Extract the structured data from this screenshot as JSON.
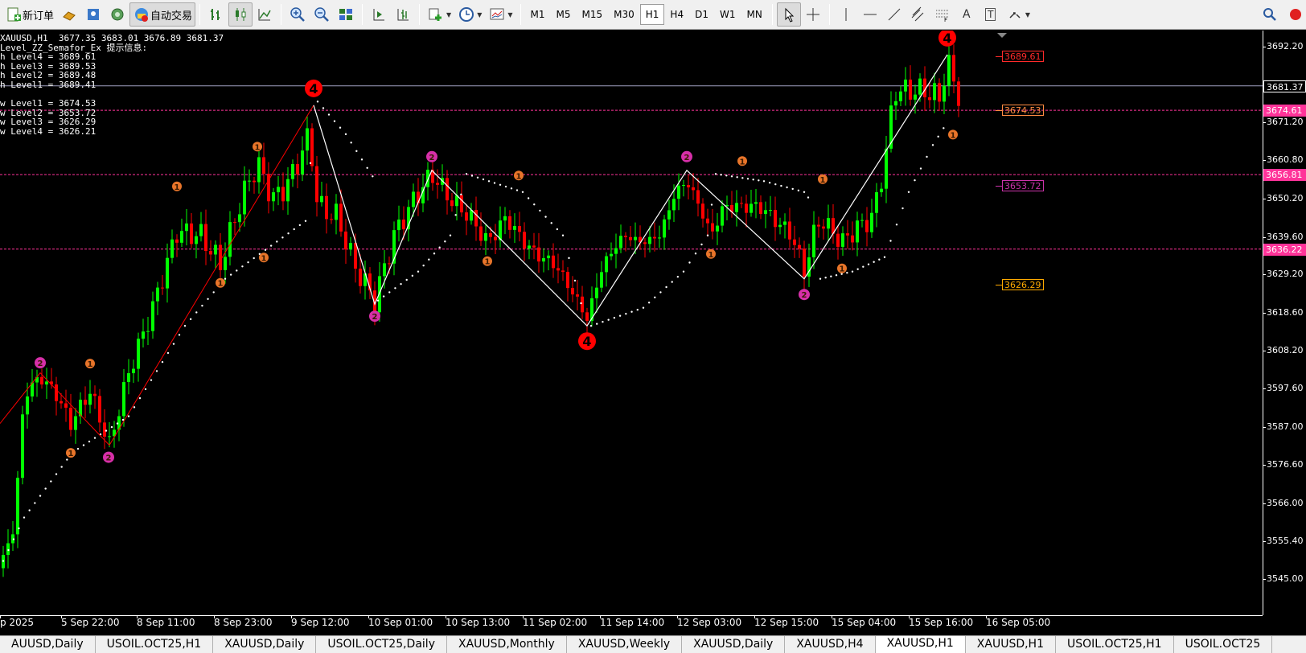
{
  "toolbar": {
    "new_order": "新订单",
    "auto_trade": "自动交易",
    "timeframes": [
      "M1",
      "M5",
      "M15",
      "M30",
      "H1",
      "H4",
      "D1",
      "W1",
      "MN"
    ],
    "active_timeframe": "H1",
    "text_tool": "A",
    "label_tool": "T"
  },
  "info": {
    "header": "XAUUSD,H1  3677.35 3683.01 3676.89 3681.37",
    "indicator": "Level_ZZ_Semafor_Ex 提示信息:",
    "lines": [
      "h Level4 = 3689.61",
      "h Level3 = 3689.53",
      "h Level2 = 3689.48",
      "h Level1 = 3689.41",
      "",
      "w Level1 = 3674.53",
      "w Level2 = 3653.72",
      "w Level3 = 3626.29",
      "w Level4 = 3626.21"
    ]
  },
  "chart_data": {
    "type": "candlestick",
    "symbol": "XAUUSD",
    "timeframe": "H1",
    "ylim": [
      3540,
      3700
    ],
    "price_ticks": [
      "3692.20",
      "3681.37",
      "3671.20",
      "3660.80",
      "3650.20",
      "3639.60",
      "3629.20",
      "3618.60",
      "3608.20",
      "3597.60",
      "3587.00",
      "3576.60",
      "3566.00",
      "3555.40",
      "3545.00"
    ],
    "price_tick_values": [
      3692.2,
      3681.37,
      3671.2,
      3660.8,
      3650.2,
      3639.6,
      3629.2,
      3618.6,
      3608.2,
      3597.6,
      3587.0,
      3576.6,
      3566.0,
      3555.4,
      3545.0
    ],
    "current_price": 3681.37,
    "level_lines": [
      {
        "price": 3674.61,
        "label": "3674.61",
        "color": "#ff3399"
      },
      {
        "price": 3656.81,
        "label": "3656.81",
        "color": "#ff3399"
      },
      {
        "price": 3636.22,
        "label": "3636.22",
        "color": "#ff3399"
      }
    ],
    "level_labels": [
      {
        "price": 3689.61,
        "label": "3689.61",
        "color": "#ff2a2a"
      },
      {
        "price": 3674.53,
        "label": "3674.53",
        "color": "#ff8c42"
      },
      {
        "price": 3653.72,
        "label": "3653.72",
        "color": "#cc33aa"
      },
      {
        "price": 3626.29,
        "label": "3626.29",
        "color": "#ffaa00"
      }
    ],
    "time_labels": [
      "p 2025",
      "5 Sep 22:00",
      "8 Sep 11:00",
      "8 Sep 23:00",
      "9 Sep 12:00",
      "10 Sep 01:00",
      "10 Sep 13:00",
      "11 Sep 02:00",
      "11 Sep 14:00",
      "12 Sep 03:00",
      "12 Sep 15:00",
      "15 Sep 04:00",
      "15 Sep 16:00",
      "16 Sep 05:00"
    ],
    "zigzag_white": [
      [
        390,
        3676
      ],
      [
        466,
        3621
      ],
      [
        537,
        3658
      ],
      [
        730,
        3615
      ],
      [
        854,
        3658
      ],
      [
        1000,
        3628
      ],
      [
        1178,
        3690
      ]
    ],
    "zigzag_red": [
      [
        0,
        3588
      ],
      [
        50,
        3602
      ],
      [
        136,
        3582
      ],
      [
        390,
        3676
      ]
    ],
    "semafor": [
      {
        "x": 50,
        "p": 3601,
        "level": 2,
        "below": false
      },
      {
        "x": 112,
        "p": 3601,
        "level": 1,
        "below": false
      },
      {
        "x": 88,
        "p": 3583,
        "level": 1,
        "below": true
      },
      {
        "x": 135,
        "p": 3582,
        "level": 2,
        "below": true
      },
      {
        "x": 220,
        "p": 3650,
        "level": 1,
        "below": false
      },
      {
        "x": 274,
        "p": 3630,
        "level": 1,
        "below": true
      },
      {
        "x": 320,
        "p": 3661,
        "level": 1,
        "below": false
      },
      {
        "x": 328,
        "p": 3637,
        "level": 1,
        "below": true
      },
      {
        "x": 390,
        "p": 3676,
        "level": 4,
        "below": false
      },
      {
        "x": 466,
        "p": 3621,
        "level": 2,
        "below": true
      },
      {
        "x": 537,
        "p": 3658,
        "level": 2,
        "below": false
      },
      {
        "x": 606,
        "p": 3636,
        "level": 1,
        "below": true
      },
      {
        "x": 645,
        "p": 3653,
        "level": 1,
        "below": false
      },
      {
        "x": 730,
        "p": 3615,
        "level": 4,
        "below": true
      },
      {
        "x": 854,
        "p": 3658,
        "level": 2,
        "below": false
      },
      {
        "x": 884,
        "p": 3638,
        "level": 1,
        "below": true
      },
      {
        "x": 923,
        "p": 3657,
        "level": 1,
        "below": false
      },
      {
        "x": 1000,
        "p": 3627,
        "level": 2,
        "below": true
      },
      {
        "x": 1023,
        "p": 3652,
        "level": 1,
        "below": false
      },
      {
        "x": 1047,
        "p": 3634,
        "level": 1,
        "below": true
      },
      {
        "x": 1178,
        "p": 3690,
        "level": 4,
        "below": false
      },
      {
        "x": 1185,
        "p": 3671,
        "level": 1,
        "below": true
      }
    ],
    "colors": {
      "bull": "#00ff00",
      "bear": "#ff0000",
      "zigzag": "#ffffff",
      "zigzag_red": "#ff0000",
      "level_line": "#ff3399",
      "dots": "#ffffff",
      "level1": "#e8752a",
      "level2": "#d62fa8",
      "level4": "#ff0000"
    }
  },
  "tabs": {
    "items": [
      "AUUSD,Daily",
      "USOIL.OCT25,H1",
      "XAUUSD,Daily",
      "USOIL.OCT25,Daily",
      "XAUUSD,Monthly",
      "XAUUSD,Weekly",
      "XAUUSD,Daily",
      "XAUUSD,H4",
      "XAUUSD,H1",
      "XAUUSD,H1",
      "USOIL.OCT25,H1",
      "USOIL.OCT25"
    ],
    "active_index": 8
  }
}
